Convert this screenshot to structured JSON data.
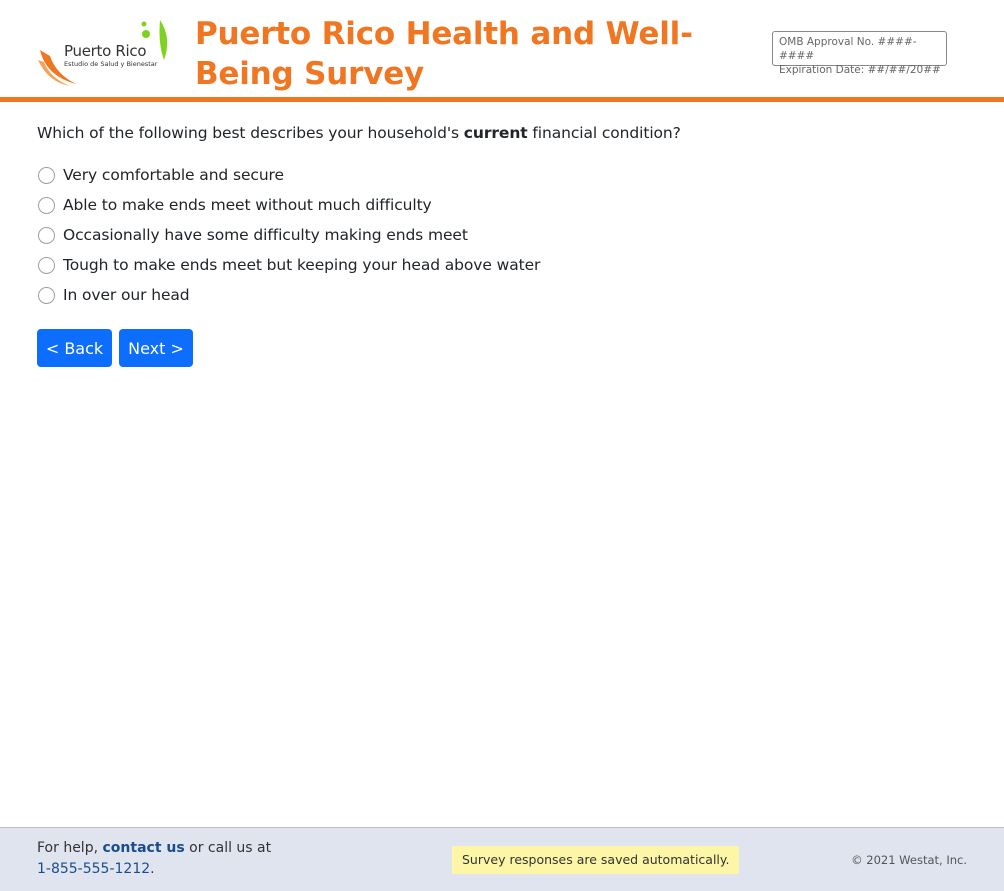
{
  "header": {
    "logo_title": "Puerto Rico",
    "logo_subtitle": "Estudio de Salud y Bienestar",
    "title": "Puerto Rico Health and Well-Being Survey",
    "omb_line1": "OMB Approval No. ####-####",
    "omb_line2": "Expiration Date: ##/##/20##"
  },
  "question": {
    "prefix": "Which of the following best describes your household's ",
    "emphasis": "current",
    "suffix": " financial condition?"
  },
  "options": [
    "Very comfortable and secure",
    "Able to make ends meet without much difficulty",
    "Occasionally have some difficulty making ends meet",
    "Tough to make ends meet but keeping your head above water",
    "In over our head"
  ],
  "buttons": {
    "back": "< Back",
    "next": "Next >"
  },
  "footer": {
    "help_prefix": "For help, ",
    "contact_link": "contact us",
    "help_middle": " or call us at",
    "phone": "1-855-555-1212",
    "phone_suffix": ".",
    "saved_note": "Survey responses are saved automatically.",
    "copyright": "© 2021 Westat, Inc."
  },
  "colors": {
    "brand_orange": "#f07622",
    "logo_green": "#7ed321",
    "primary_button": "#0d6efd",
    "footer_bg": "#dfe4ef",
    "saved_bg": "#fdf6a7"
  },
  "icons": {
    "logo": "hands-and-leaves-logo"
  }
}
